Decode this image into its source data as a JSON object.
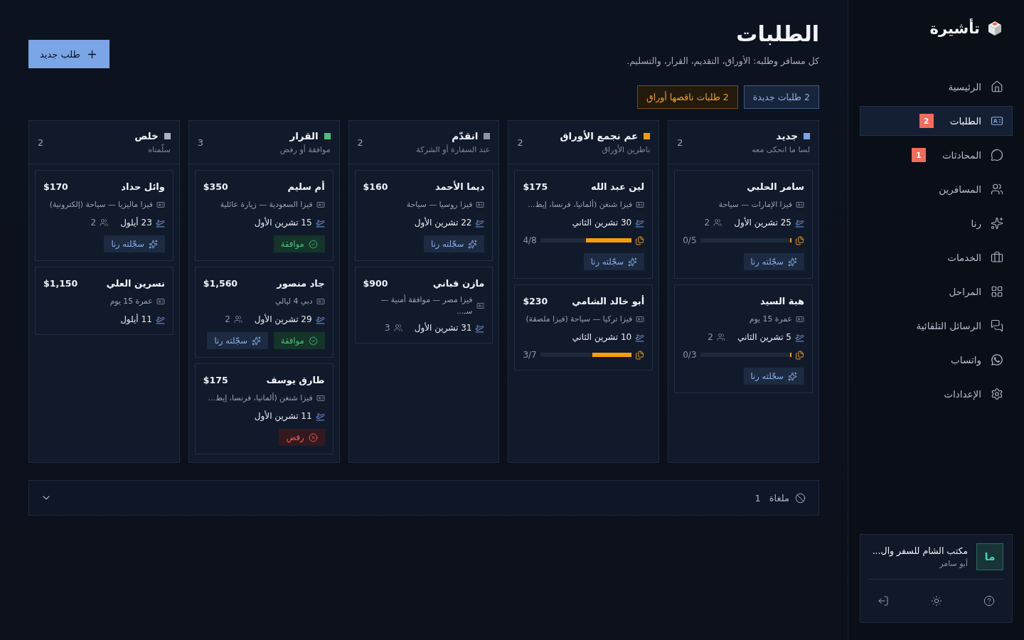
{
  "sidebar": {
    "brand": "تأشيرة",
    "nav": [
      {
        "label": "الرئيسية",
        "selected": false
      },
      {
        "label": "الطلبات",
        "selected": true,
        "badge": "2"
      },
      {
        "label": "المحادثات",
        "selected": false,
        "badge": "1"
      },
      {
        "label": "المسافرين",
        "selected": false
      },
      {
        "label": "رنا",
        "selected": false
      },
      {
        "label": "الخدمات",
        "selected": false
      },
      {
        "label": "المراحل",
        "selected": false
      },
      {
        "label": "الرسائل التلقائية",
        "selected": false
      },
      {
        "label": "واتساب",
        "selected": false
      },
      {
        "label": "الإعدادات",
        "selected": false
      }
    ],
    "account": {
      "avatar": "ما",
      "name": "مكتب الشام للسفر وال...",
      "user": "أبو سامر"
    }
  },
  "header": {
    "title": "الطلبات",
    "subtitle": "كل مسافر وطلبه: الأوراق، التقديم، القرار، والتسليم.",
    "new_button": "طلب جديد",
    "chips": [
      {
        "label": "2 طلبات جديدة",
        "kind": "info"
      },
      {
        "label": "2 طلبات ناقصها أوراق",
        "kind": "warning"
      }
    ]
  },
  "columns": [
    {
      "title": "جديد",
      "subtitle": "لسا ما انحكى معه",
      "count": "2",
      "color": "#7aa5e6",
      "cards": [
        {
          "name": "سامر الحلبي",
          "visa": "فيزا الإمارات — سياحة",
          "date": "25 تشرين الأول",
          "travelers": "2",
          "docs": {
            "text": "0/5",
            "level": 0
          },
          "badges": [
            {
              "kind": "rana",
              "label": "سجّلته رنا"
            }
          ]
        },
        {
          "name": "هبة السيد",
          "visa": "عمرة 15 يوم",
          "date": "5 تشرين الثاني",
          "travelers": "2",
          "docs": {
            "text": "0/3",
            "level": 0
          },
          "badges": [
            {
              "kind": "rana",
              "label": "سجّلته رنا"
            }
          ]
        }
      ]
    },
    {
      "title": "عم نجمع الأوراق",
      "subtitle": "ناطرين الأوراق",
      "count": "2",
      "color": "#f59e0b",
      "cards": [
        {
          "name": "لين عبد الله",
          "price": "$175",
          "visa": "فيزا شنغن (ألمانيا، فرنسا، إيط...",
          "date": "30 تشرين الثاني",
          "docs": {
            "text": "4/8",
            "level": 0.5
          },
          "badges": [
            {
              "kind": "rana",
              "label": "سجّلته رنا"
            }
          ]
        },
        {
          "name": "أبو خالد الشامي",
          "price": "$230",
          "visa": "فيزا تركيا — سياحة (فيزا ملصقة)",
          "date": "10 تشرين الثاني",
          "docs": {
            "text": "3/7",
            "level": 0.43
          }
        }
      ]
    },
    {
      "title": "انقدّم",
      "subtitle": "عند السفارة أو الشركة",
      "count": "2",
      "color": "#8b95a5",
      "cards": [
        {
          "name": "ديما الأحمد",
          "price": "$160",
          "visa": "فيزا روسيا — سياحة",
          "date": "22 تشرين الأول",
          "badges": [
            {
              "kind": "rana",
              "label": "سجّلته رنا"
            }
          ]
        },
        {
          "name": "مازن قباني",
          "price": "$900",
          "visa": "فيزا مصر — موافقة أمنية — سـ...",
          "date": "31 تشرين الأول",
          "travelers": "3"
        }
      ]
    },
    {
      "title": "القرار",
      "subtitle": "موافقة أو رفض",
      "count": "3",
      "color": "#4cc07a",
      "cards": [
        {
          "name": "أم سليم",
          "price": "$350",
          "visa": "فيزا السعودية — زيارة عائلية",
          "date": "15 تشرين الأول",
          "badges": [
            {
              "kind": "approved",
              "label": "موافقة"
            }
          ]
        },
        {
          "name": "جاد منصور",
          "price": "$1,560",
          "visa": "دبي 4 ليالي",
          "date": "29 تشرين الأول",
          "travelers": "2",
          "badges": [
            {
              "kind": "approved",
              "label": "موافقة"
            },
            {
              "kind": "rana",
              "label": "سجّلته رنا"
            }
          ]
        },
        {
          "name": "طارق يوسف",
          "price": "$175",
          "visa": "فيزا شنغن (ألمانيا، فرنسا، إيط...",
          "date": "11 تشرين الأول",
          "badges": [
            {
              "kind": "rejected",
              "label": "رفض"
            }
          ]
        }
      ]
    },
    {
      "title": "خلص",
      "subtitle": "سلّمناه",
      "count": "2",
      "color": "#a9b3c3",
      "cards": [
        {
          "name": "وائل حداد",
          "price": "$170",
          "visa": "فيزا ماليزيا — سياحة (إلكترونية)",
          "date": "23 أيلول",
          "travelers": "2",
          "badges": [
            {
              "kind": "rana",
              "label": "سجّلته رنا"
            }
          ]
        },
        {
          "name": "نسرين العلي",
          "price": "$1,150",
          "visa": "عمرة 15 يوم",
          "date": "11 أيلول"
        }
      ]
    }
  ],
  "cancelled": {
    "label": "ملغاة",
    "count": "1",
    "expanded": false
  }
}
